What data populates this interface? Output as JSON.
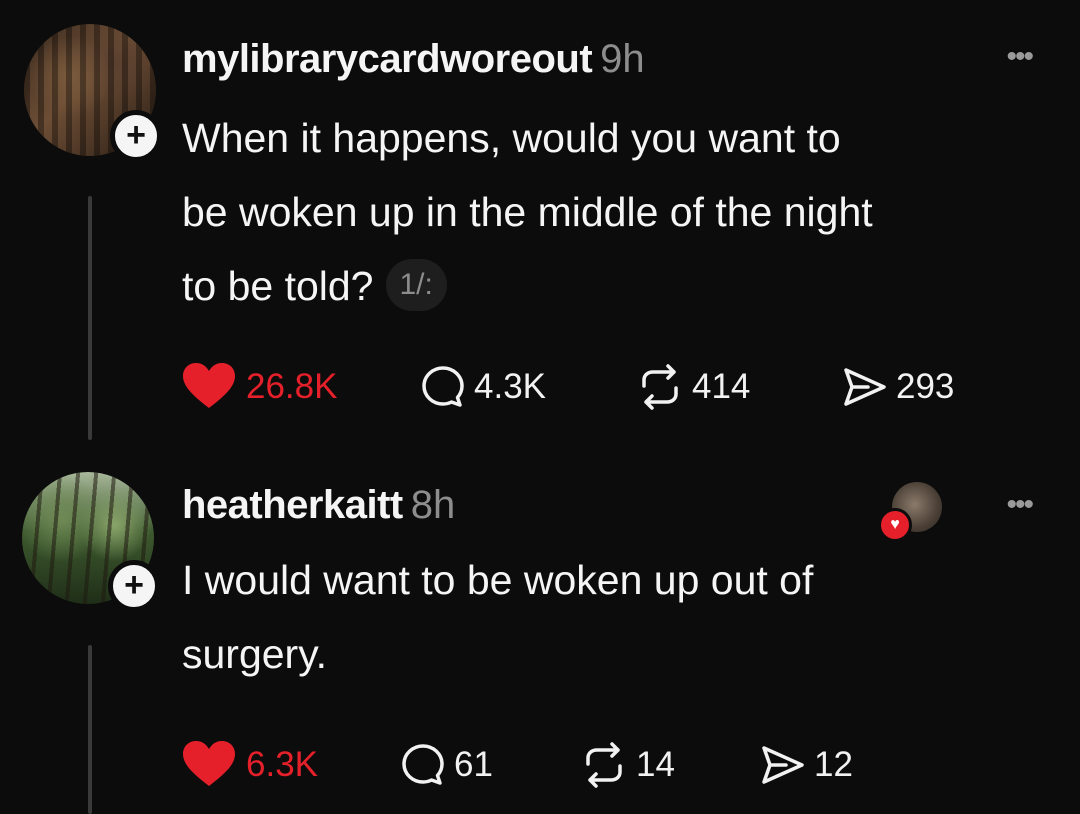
{
  "posts": [
    {
      "username": "mylibrarycardworeout",
      "time": "9h",
      "text_lines": [
        "When it happens, would you want to",
        "be woken up in the middle of the night",
        "to be told?"
      ],
      "page_indicator": "1/:",
      "likes": "26.8K",
      "replies": "4.3K",
      "reposts": "414",
      "shares": "293",
      "liked": true
    },
    {
      "username": "heatherkaitt",
      "time": "8h",
      "text_lines": [
        "I would want to be woken up out of",
        "surgery."
      ],
      "likes": "6.3K",
      "replies": "61",
      "reposts": "14",
      "shares": "12",
      "liked": true,
      "liked_by_author": true
    }
  ],
  "icons": {
    "more": "more-dots-icon",
    "follow": "plus-icon",
    "like": "heart-icon",
    "reply": "comment-bubble-icon",
    "repost": "repost-arrows-icon",
    "share": "send-icon"
  },
  "colors": {
    "background": "#0c0c0c",
    "like_red": "#e6202a",
    "muted": "#8d8d8d",
    "text": "#f5f5f5"
  }
}
